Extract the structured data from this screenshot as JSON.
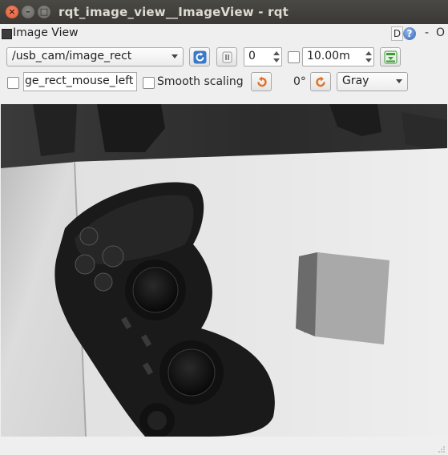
{
  "window": {
    "title": "rqt_image_view__ImageView - rqt",
    "close_glyph": "×",
    "min_glyph": "–",
    "max_glyph": "□"
  },
  "dock": {
    "title": "Image View",
    "d_label": "D",
    "help_label": "?",
    "min_label": "-",
    "close_label": "O"
  },
  "toolbar": {
    "topic": "/usb_cam/image_rect",
    "counter_value": "0",
    "time_value": "10.00m",
    "mouse_topic": "ge_rect_mouse_left",
    "smooth_label": "Smooth scaling",
    "rotation_label": "0°",
    "color_scheme": "Gray"
  },
  "colors": {
    "accent_blue": "#3a78c9",
    "rotate_orange": "#e2701f",
    "save_green": "#3f9a3a"
  },
  "icons": [
    "refresh-icon",
    "pause-icon",
    "save-image-icon",
    "rotate-left-icon",
    "rotate-right-icon",
    "help-icon"
  ]
}
